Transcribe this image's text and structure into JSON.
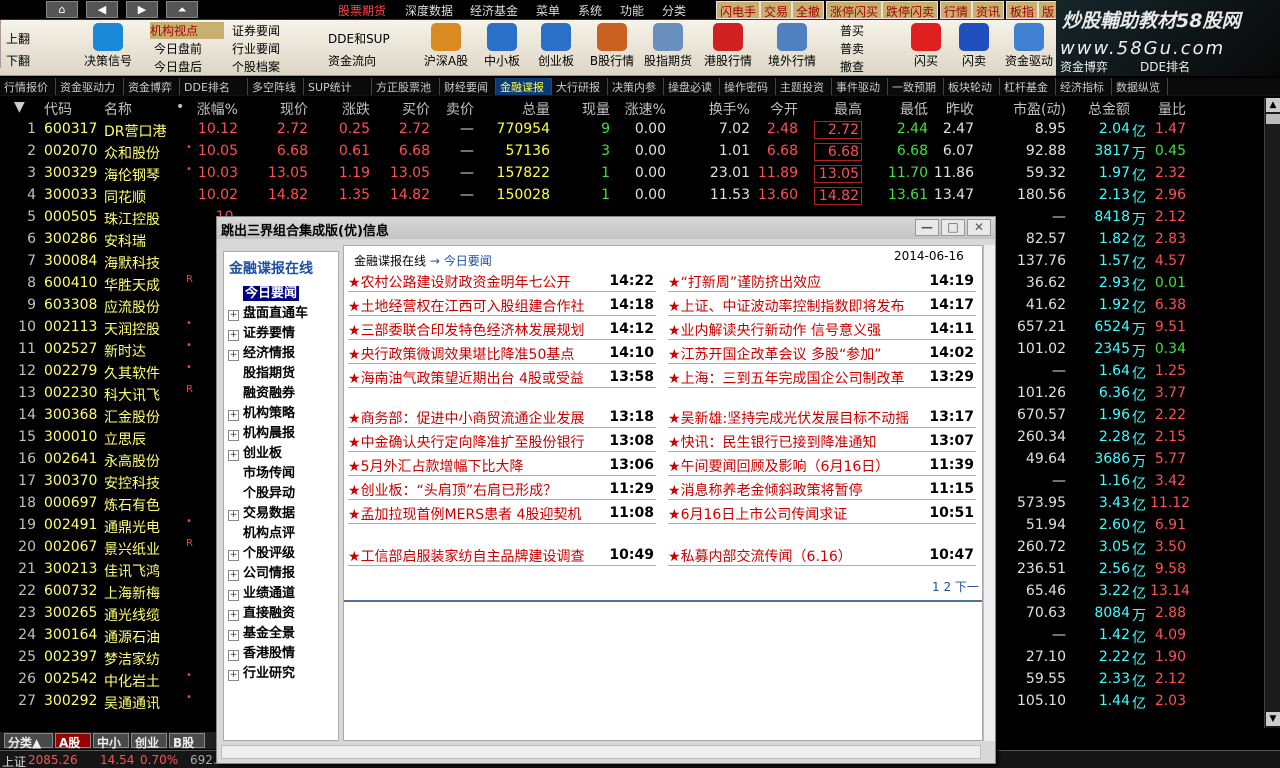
{
  "menu": {
    "nav_icons": [
      "home-icon",
      "back-arrow-icon",
      "forward-arrow-icon",
      "up-arrow-icon"
    ],
    "items": [
      {
        "label": "股票期货",
        "active": true
      },
      {
        "label": "深度数据"
      },
      {
        "label": "经济基金"
      },
      {
        "label": "菜单"
      },
      {
        "label": "系统"
      },
      {
        "label": "功能"
      },
      {
        "label": "分类"
      }
    ],
    "right_buttons": [
      "闪电手",
      "交易",
      "全撤",
      "涨停闪买",
      "跌停闪卖",
      "行情",
      "资讯",
      "板指",
      "版"
    ]
  },
  "toolbar": {
    "shangfan": "上翻",
    "xiafan": "下翻",
    "decision": "决策信号",
    "institution": "机构视点",
    "today_open": "今日盘前",
    "today_after": "今日盘后",
    "securities_news": "证券要闻",
    "industry_news": "行业要闻",
    "stock_archive": "个股档案",
    "dde_sup": "DDE和SUP",
    "fund_flow": "资金流向",
    "big": [
      {
        "label": "沪深A股",
        "icon": "a-shares-icon"
      },
      {
        "label": "中小板",
        "icon": "sme-board-icon"
      },
      {
        "label": "创业板",
        "icon": "gem-board-icon"
      },
      {
        "label": "B股行情",
        "icon": "b-shares-icon"
      },
      {
        "label": "股指期货",
        "icon": "index-futures-icon"
      },
      {
        "label": "港股行情",
        "icon": "hk-stocks-icon"
      },
      {
        "label": "境外行情",
        "icon": "overseas-icon"
      }
    ],
    "normal_buy": "普买",
    "normal_sell": "普卖",
    "cancel_order": "撤查",
    "flash_buy": "闪买",
    "flash_sell": "闪卖",
    "fund_drive": "资金驱动",
    "fund_game": "资金博弈",
    "dde_rank": "DDE排名"
  },
  "logo": {
    "line1": "炒股輔助教材58股网",
    "line2": "www.58Gu.com"
  },
  "tabs": [
    "行情报价",
    "资金驱动力",
    "资金博弈",
    "DDE排名",
    "多空阵线",
    "SUP统计",
    "方正股票池",
    "财经要闻",
    "金融谍报",
    "大行研报",
    "决策内参",
    "操盘必读",
    "操作密码",
    "主题投资",
    "事件驱动",
    "一致预期",
    "板块轮动",
    "杠杆基金",
    "经济指标",
    "数据纵览"
  ],
  "active_tab": "金融谍报",
  "table": {
    "headers": [
      "代码",
      "名称",
      "•",
      "涨幅%",
      "现价",
      "涨跌",
      "买价",
      "卖价",
      "总量",
      "现量",
      "涨速%",
      "换手%",
      "今开",
      "最高",
      "最低",
      "昨收",
      "市盈(动)",
      "总金额",
      "量比"
    ],
    "rows": [
      {
        "no": "1",
        "code": "600317",
        "name": "DR营口港",
        "mark": "",
        "chg_pct": "10.12",
        "price": "2.72",
        "chg": "0.25",
        "bid": "2.72",
        "ask": "—",
        "vol": "770954",
        "cur": "9",
        "speed": "0.00",
        "turn": "7.02",
        "open": "2.48",
        "high": "2.72",
        "low": "2.44",
        "prev": "2.47",
        "pe": "8.95",
        "amount": "2.04",
        "amt_unit": "亿",
        "ratio": "1.47"
      },
      {
        "no": "2",
        "code": "002070",
        "name": "众和股份",
        "mark": "•",
        "chg_pct": "10.05",
        "price": "6.68",
        "chg": "0.61",
        "bid": "6.68",
        "ask": "—",
        "vol": "57136",
        "cur": "3",
        "speed": "0.00",
        "turn": "1.01",
        "open": "6.68",
        "high": "6.68",
        "low": "6.68",
        "prev": "6.07",
        "pe": "92.88",
        "amount": "3817",
        "amt_unit": "万",
        "ratio": "0.45"
      },
      {
        "no": "3",
        "code": "300329",
        "name": "海伦钢琴",
        "mark": "•",
        "chg_pct": "10.03",
        "price": "13.05",
        "chg": "1.19",
        "bid": "13.05",
        "ask": "—",
        "vol": "157822",
        "cur": "1",
        "speed": "0.00",
        "turn": "23.01",
        "open": "11.89",
        "high": "13.05",
        "low": "11.70",
        "prev": "11.86",
        "pe": "59.32",
        "amount": "1.97",
        "amt_unit": "亿",
        "ratio": "2.32"
      },
      {
        "no": "4",
        "code": "300033",
        "name": "同花顺",
        "mark": "",
        "chg_pct": "10.02",
        "price": "14.82",
        "chg": "1.35",
        "bid": "14.82",
        "ask": "—",
        "vol": "150028",
        "cur": "1",
        "speed": "0.00",
        "turn": "11.53",
        "open": "13.60",
        "high": "14.82",
        "low": "13.61",
        "prev": "13.47",
        "pe": "180.56",
        "amount": "2.13",
        "amt_unit": "亿",
        "ratio": "2.96"
      },
      {
        "no": "5",
        "code": "000505",
        "name": "珠江控股",
        "mark": "",
        "chg_pct": "10.",
        "price": "",
        "chg": "",
        "bid": "",
        "ask": "",
        "vol": "",
        "cur": "",
        "speed": "",
        "turn": "",
        "open": "",
        "high": "",
        "low": "",
        "prev": "",
        "pe": "—",
        "amount": "8418",
        "amt_unit": "万",
        "ratio": "2.12"
      },
      {
        "no": "6",
        "code": "300286",
        "name": "安科瑞",
        "mark": "",
        "chg_pct": "1",
        "price": "",
        "chg": "",
        "bid": "",
        "ask": "",
        "vol": "",
        "cur": "",
        "speed": "",
        "turn": "",
        "open": "",
        "high": "",
        "low": "",
        "prev": "",
        "pe": "82.57",
        "amount": "1.82",
        "amt_unit": "亿",
        "ratio": "2.83"
      },
      {
        "no": "7",
        "code": "300084",
        "name": "海默科技",
        "mark": "",
        "chg_pct": "1",
        "price": "",
        "chg": "",
        "bid": "",
        "ask": "",
        "vol": "",
        "cur": "",
        "speed": "",
        "turn": "",
        "open": "",
        "high": "",
        "low": "",
        "prev": "",
        "pe": "137.76",
        "amount": "1.57",
        "amt_unit": "亿",
        "ratio": "4.57"
      },
      {
        "no": "8",
        "code": "600410",
        "name": "华胜天成",
        "mark": "R",
        "chg_pct": "1",
        "price": "",
        "chg": "",
        "bid": "",
        "ask": "",
        "vol": "",
        "cur": "",
        "speed": "",
        "turn": "",
        "open": "",
        "high": "",
        "low": "",
        "prev": "",
        "pe": "36.62",
        "amount": "2.93",
        "amt_unit": "亿",
        "ratio": "0.01"
      },
      {
        "no": "9",
        "code": "603308",
        "name": "应流股份",
        "mark": "",
        "chg_pct": "1",
        "price": "",
        "chg": "",
        "bid": "",
        "ask": "",
        "vol": "",
        "cur": "",
        "speed": "",
        "turn": "",
        "open": "",
        "high": "",
        "low": "",
        "prev": "",
        "pe": "41.62",
        "amount": "1.92",
        "amt_unit": "亿",
        "ratio": "6.38"
      },
      {
        "no": "10",
        "code": "002113",
        "name": "天润控股",
        "mark": "•",
        "chg_pct": "1",
        "price": "",
        "chg": "",
        "bid": "",
        "ask": "",
        "vol": "",
        "cur": "",
        "speed": "",
        "turn": "",
        "open": "",
        "high": "",
        "low": "",
        "prev": "",
        "pe": "657.21",
        "amount": "6524",
        "amt_unit": "万",
        "ratio": "9.51"
      },
      {
        "no": "11",
        "code": "002527",
        "name": "新时达",
        "mark": "•",
        "chg_pct": "1",
        "price": "",
        "chg": "",
        "bid": "",
        "ask": "",
        "vol": "",
        "cur": "",
        "speed": "",
        "turn": "",
        "open": "",
        "high": "",
        "low": "",
        "prev": "",
        "pe": "101.02",
        "amount": "2345",
        "amt_unit": "万",
        "ratio": "0.34"
      },
      {
        "no": "12",
        "code": "002279",
        "name": "久其软件",
        "mark": "•",
        "chg_pct": "1",
        "price": "",
        "chg": "",
        "bid": "",
        "ask": "",
        "vol": "",
        "cur": "",
        "speed": "",
        "turn": "",
        "open": "",
        "high": "",
        "low": "",
        "prev": "",
        "pe": "—",
        "amount": "1.64",
        "amt_unit": "亿",
        "ratio": "1.25"
      },
      {
        "no": "13",
        "code": "002230",
        "name": "科大讯飞",
        "mark": "R",
        "chg_pct": "1",
        "price": "",
        "chg": "",
        "bid": "",
        "ask": "",
        "vol": "",
        "cur": "",
        "speed": "",
        "turn": "",
        "open": "",
        "high": "",
        "low": "",
        "prev": "",
        "pe": "101.26",
        "amount": "6.36",
        "amt_unit": "亿",
        "ratio": "3.77"
      },
      {
        "no": "14",
        "code": "300368",
        "name": "汇金股份",
        "mark": "",
        "chg_pct": "1",
        "price": "",
        "chg": "",
        "bid": "",
        "ask": "",
        "vol": "",
        "cur": "",
        "speed": "",
        "turn": "",
        "open": "",
        "high": "",
        "low": "",
        "prev": "",
        "pe": "670.57",
        "amount": "1.96",
        "amt_unit": "亿",
        "ratio": "2.22"
      },
      {
        "no": "15",
        "code": "300010",
        "name": "立思辰",
        "mark": "",
        "chg_pct": "1",
        "price": "",
        "chg": "",
        "bid": "",
        "ask": "",
        "vol": "",
        "cur": "",
        "speed": "",
        "turn": "",
        "open": "",
        "high": "",
        "low": "",
        "prev": "",
        "pe": "260.34",
        "amount": "2.28",
        "amt_unit": "亿",
        "ratio": "2.15"
      },
      {
        "no": "16",
        "code": "002641",
        "name": "永高股份",
        "mark": "",
        "chg_pct": "",
        "price": "",
        "chg": "",
        "bid": "",
        "ask": "",
        "vol": "",
        "cur": "",
        "speed": "",
        "turn": "",
        "open": "",
        "high": "",
        "low": "",
        "prev": "",
        "pe": "49.64",
        "amount": "3686",
        "amt_unit": "万",
        "ratio": "5.77"
      },
      {
        "no": "17",
        "code": "300370",
        "name": "安控科技",
        "mark": "",
        "chg_pct": "",
        "price": "",
        "chg": "",
        "bid": "",
        "ask": "",
        "vol": "",
        "cur": "",
        "speed": "",
        "turn": "",
        "open": "",
        "high": "",
        "low": "",
        "prev": "",
        "pe": "—",
        "amount": "1.16",
        "amt_unit": "亿",
        "ratio": "3.42"
      },
      {
        "no": "18",
        "code": "000697",
        "name": "炼石有色",
        "mark": "",
        "chg_pct": "",
        "price": "",
        "chg": "",
        "bid": "",
        "ask": "",
        "vol": "",
        "cur": "",
        "speed": "",
        "turn": "",
        "open": "",
        "high": "",
        "low": "",
        "prev": "",
        "pe": "573.95",
        "amount": "3.43",
        "amt_unit": "亿",
        "ratio": "11.12"
      },
      {
        "no": "19",
        "code": "002491",
        "name": "通鼎光电",
        "mark": "•",
        "chg_pct": "",
        "price": "",
        "chg": "",
        "bid": "",
        "ask": "",
        "vol": "",
        "cur": "",
        "speed": "",
        "turn": "",
        "open": "",
        "high": "",
        "low": "",
        "prev": "",
        "pe": "51.94",
        "amount": "2.60",
        "amt_unit": "亿",
        "ratio": "6.91"
      },
      {
        "no": "20",
        "code": "002067",
        "name": "景兴纸业",
        "mark": "R",
        "chg_pct": "",
        "price": "",
        "chg": "",
        "bid": "",
        "ask": "",
        "vol": "",
        "cur": "",
        "speed": "",
        "turn": "",
        "open": "",
        "high": "",
        "low": "",
        "prev": "",
        "pe": "260.72",
        "amount": "3.05",
        "amt_unit": "亿",
        "ratio": "3.50"
      },
      {
        "no": "21",
        "code": "300213",
        "name": "佳讯飞鸿",
        "mark": "",
        "chg_pct": "",
        "price": "",
        "chg": "",
        "bid": "",
        "ask": "",
        "vol": "",
        "cur": "",
        "speed": "",
        "turn": "",
        "open": "",
        "high": "",
        "low": "",
        "prev": "",
        "pe": "236.51",
        "amount": "2.56",
        "amt_unit": "亿",
        "ratio": "9.58"
      },
      {
        "no": "22",
        "code": "600732",
        "name": "上海新梅",
        "mark": "",
        "chg_pct": "",
        "price": "",
        "chg": "",
        "bid": "",
        "ask": "",
        "vol": "",
        "cur": "",
        "speed": "",
        "turn": "",
        "open": "",
        "high": "",
        "low": "",
        "prev": "",
        "pe": "65.46",
        "amount": "3.22",
        "amt_unit": "亿",
        "ratio": "13.14"
      },
      {
        "no": "23",
        "code": "300265",
        "name": "通光线缆",
        "mark": "",
        "chg_pct": "",
        "price": "",
        "chg": "",
        "bid": "",
        "ask": "",
        "vol": "",
        "cur": "",
        "speed": "",
        "turn": "",
        "open": "",
        "high": "",
        "low": "",
        "prev": "",
        "pe": "70.63",
        "amount": "8084",
        "amt_unit": "万",
        "ratio": "2.88"
      },
      {
        "no": "24",
        "code": "300164",
        "name": "通源石油",
        "mark": "",
        "chg_pct": "",
        "price": "",
        "chg": "",
        "bid": "",
        "ask": "",
        "vol": "",
        "cur": "",
        "speed": "",
        "turn": "",
        "open": "",
        "high": "",
        "low": "",
        "prev": "",
        "pe": "—",
        "amount": "1.42",
        "amt_unit": "亿",
        "ratio": "4.09"
      },
      {
        "no": "25",
        "code": "002397",
        "name": "梦洁家纺",
        "mark": "",
        "chg_pct": "",
        "price": "",
        "chg": "",
        "bid": "",
        "ask": "",
        "vol": "",
        "cur": "",
        "speed": "",
        "turn": "",
        "open": "",
        "high": "",
        "low": "",
        "prev": "",
        "pe": "27.10",
        "amount": "2.22",
        "amt_unit": "亿",
        "ratio": "1.90"
      },
      {
        "no": "26",
        "code": "002542",
        "name": "中化岩土",
        "mark": "•",
        "chg_pct": "",
        "price": "",
        "chg": "",
        "bid": "",
        "ask": "",
        "vol": "",
        "cur": "",
        "speed": "",
        "turn": "",
        "open": "",
        "high": "",
        "low": "",
        "prev": "",
        "pe": "59.55",
        "amount": "2.33",
        "amt_unit": "亿",
        "ratio": "2.12"
      },
      {
        "no": "27",
        "code": "300292",
        "name": "吴通通讯",
        "mark": "•",
        "chg_pct": "",
        "price": "",
        "chg": "",
        "bid": "",
        "ask": "",
        "vol": "",
        "cur": "",
        "speed": "",
        "turn": "",
        "open": "",
        "high": "",
        "low": "",
        "prev": "",
        "pe": "105.10",
        "amount": "1.44",
        "amt_unit": "亿",
        "ratio": "2.03"
      }
    ]
  },
  "bottom_tabs": [
    "分类▲",
    "A股",
    "中小",
    "创业",
    "B股"
  ],
  "status": {
    "index_name": "上证",
    "index_value": "2085.26",
    "index_chg": "14.54",
    "index_pct": "0.70%",
    "amount": "692.2"
  },
  "popup": {
    "title": "跳出三界组合集成版(优)信息",
    "side_header": "金融谍报在线",
    "tree": [
      {
        "label": "今日要闻",
        "expand": false,
        "selected": true
      },
      {
        "label": "盘面直通车",
        "expand": true
      },
      {
        "label": "证券要情",
        "expand": true
      },
      {
        "label": "经济情报",
        "expand": true
      },
      {
        "label": "股指期货",
        "expand": false
      },
      {
        "label": "融资融券",
        "expand": false
      },
      {
        "label": "机构策略",
        "expand": true
      },
      {
        "label": "机构晨报",
        "expand": true
      },
      {
        "label": "创业板",
        "expand": true
      },
      {
        "label": "市场传闻",
        "expand": false
      },
      {
        "label": "个股异动",
        "expand": false
      },
      {
        "label": "交易数据",
        "expand": true
      },
      {
        "label": "机构点评",
        "expand": false
      },
      {
        "label": "个股评级",
        "expand": true
      },
      {
        "label": "公司情报",
        "expand": true
      },
      {
        "label": "业绩通道",
        "expand": true
      },
      {
        "label": "直接融资",
        "expand": true
      },
      {
        "label": "基金全景",
        "expand": true
      },
      {
        "label": "香港股情",
        "expand": true
      },
      {
        "label": "行业研究",
        "expand": true
      }
    ],
    "breadcrumb_root": "金融谍报在线",
    "breadcrumb_arrow": "→",
    "breadcrumb_current": "今日要闻",
    "date": "2014-06-16",
    "news_left": [
      {
        "title": "农村公路建设财政资金明年七公开",
        "time": "14:22"
      },
      {
        "title": "土地经营权在江西可入股组建合作社",
        "time": "14:18"
      },
      {
        "title": "三部委联合印发特色经济林发展规划",
        "time": "14:12"
      },
      {
        "title": "央行政策微调效果堪比降准50基点",
        "time": "14:10"
      },
      {
        "title": "海南油气政策望近期出台 4股或受益",
        "time": "13:58"
      },
      {
        "title": "商务部：促进中小商贸流通企业发展",
        "time": "13:18"
      },
      {
        "title": "中金确认央行定向降准扩至股份银行",
        "time": "13:08"
      },
      {
        "title": "5月外汇占款增幅下比大降",
        "time": "13:06"
      },
      {
        "title": "创业板：“头肩顶”右肩已形成？",
        "time": "11:29"
      },
      {
        "title": "孟加拉现首例MERS患者 4股迎契机",
        "time": "11:08"
      },
      {
        "title": "工信部启服装家纺自主品牌建设调查",
        "time": "10:49"
      }
    ],
    "news_right": [
      {
        "title": "“打新周”谨防挤出效应",
        "time": "14:19"
      },
      {
        "title": "上证、中证波动率控制指数即将发布",
        "time": "14:17"
      },
      {
        "title": "业内解读央行新动作 信号意义强",
        "time": "14:11"
      },
      {
        "title": "江苏开国企改革会议 多股“参加”",
        "time": "14:02"
      },
      {
        "title": "上海：三到五年完成国企公司制改革",
        "time": "13:29"
      },
      {
        "title": "吴新雄:坚持完成光伏发展目标不动摇",
        "time": "13:17"
      },
      {
        "title": "快讯：民生银行已接到降准通知",
        "time": "13:07"
      },
      {
        "title": "午间要闻回顾及影响（6月16日）",
        "time": "11:39"
      },
      {
        "title": "消息称养老金倾斜政策将暂停",
        "time": "11:15"
      },
      {
        "title": "6月16日上市公司传闻求证",
        "time": "10:51"
      },
      {
        "title": "私募内部交流传闻（6.16）",
        "time": "10:47"
      }
    ],
    "pager": "1 2 下一"
  }
}
